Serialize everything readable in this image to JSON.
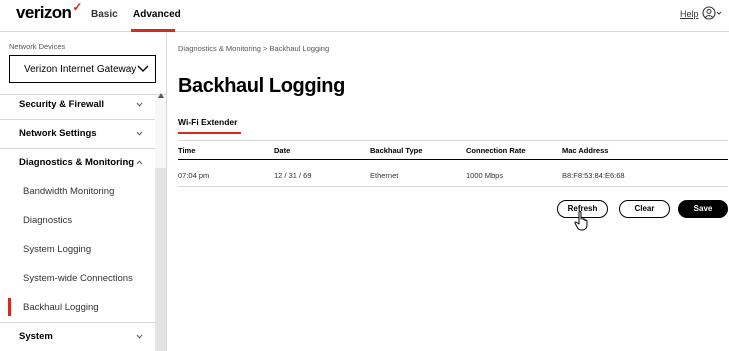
{
  "header": {
    "logo": "verizon",
    "tabs": [
      {
        "label": "Basic",
        "active": false
      },
      {
        "label": "Advanced",
        "active": true
      }
    ],
    "help_label": "Help",
    "user_icon": "user-icon",
    "accent_color": "#d52b1e"
  },
  "sidebar": {
    "network_devices_label": "Network Devices",
    "selected_device": "Verizon Internet Gateway",
    "items": [
      {
        "label": "Security & Firewall",
        "type": "section",
        "expanded": false
      },
      {
        "label": "Network Settings",
        "type": "section",
        "expanded": false
      },
      {
        "label": "Diagnostics & Monitoring",
        "type": "section",
        "expanded": true
      },
      {
        "label": "Bandwidth Monitoring",
        "type": "sub"
      },
      {
        "label": "Diagnostics",
        "type": "sub"
      },
      {
        "label": "System Logging",
        "type": "sub"
      },
      {
        "label": "System-wide Connections",
        "type": "sub"
      },
      {
        "label": "Backhaul Logging",
        "type": "sub",
        "active": true
      },
      {
        "label": "System",
        "type": "section",
        "expanded": false
      }
    ]
  },
  "main": {
    "breadcrumb": "Diagnostics & Monitoring  >  Backhaul Logging",
    "title": "Backhaul Logging",
    "sub_tab": "Wi-Fi Extender",
    "table": {
      "headers": [
        "Time",
        "Date",
        "Backhaul Type",
        "Connection Rate",
        "Mac Address"
      ],
      "rows": [
        [
          "07:04 pm",
          "12 / 31 / 69",
          "Ethernet",
          "1000 Mbps",
          "B8:F8:53:84:E6:68"
        ]
      ]
    },
    "buttons": {
      "refresh": "Refresh",
      "clear": "Clear",
      "save": "Save"
    }
  }
}
